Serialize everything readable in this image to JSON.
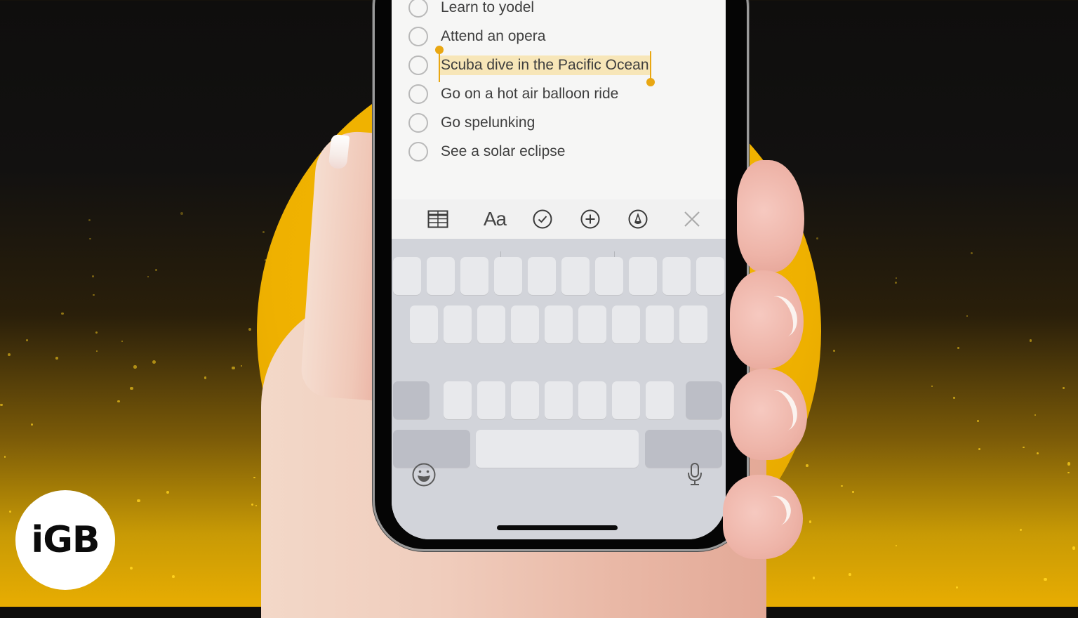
{
  "scene": {
    "colors": {
      "background_top": "#0f0e0d",
      "background_bottom": "#e8ad02",
      "sun_circle": "#f3b400",
      "selection_highlight": "#f7e6b8",
      "selection_handle": "#e9a712",
      "keyboard_bg": "#d2d4da",
      "key_light": "#e8e9ec",
      "key_dark": "#bcbec6"
    }
  },
  "notes": {
    "checklist": [
      {
        "label": "Learn to yodel",
        "checked": false,
        "selected": false
      },
      {
        "label": "Attend an opera",
        "checked": false,
        "selected": false
      },
      {
        "label": "Scuba dive in the Pacific Ocean",
        "checked": false,
        "selected": true
      },
      {
        "label": "Go on a hot air balloon ride",
        "checked": false,
        "selected": false
      },
      {
        "label": "Go spelunking",
        "checked": false,
        "selected": false
      },
      {
        "label": "See a solar eclipse",
        "checked": false,
        "selected": false
      }
    ]
  },
  "toolbar": {
    "items": [
      {
        "icon": "table-icon",
        "label": ""
      },
      {
        "icon": "format-text-icon",
        "label": "Aa"
      },
      {
        "icon": "checklist-icon",
        "label": ""
      },
      {
        "icon": "add-icon",
        "label": ""
      },
      {
        "icon": "markup-pen-icon",
        "label": ""
      },
      {
        "icon": "close-icon",
        "label": ""
      }
    ]
  },
  "keyboard": {
    "rows": [
      10,
      9,
      7
    ],
    "bottom_icons": [
      "emoji-icon",
      "microphone-icon"
    ]
  },
  "brand": {
    "logo_text": "iGB"
  }
}
